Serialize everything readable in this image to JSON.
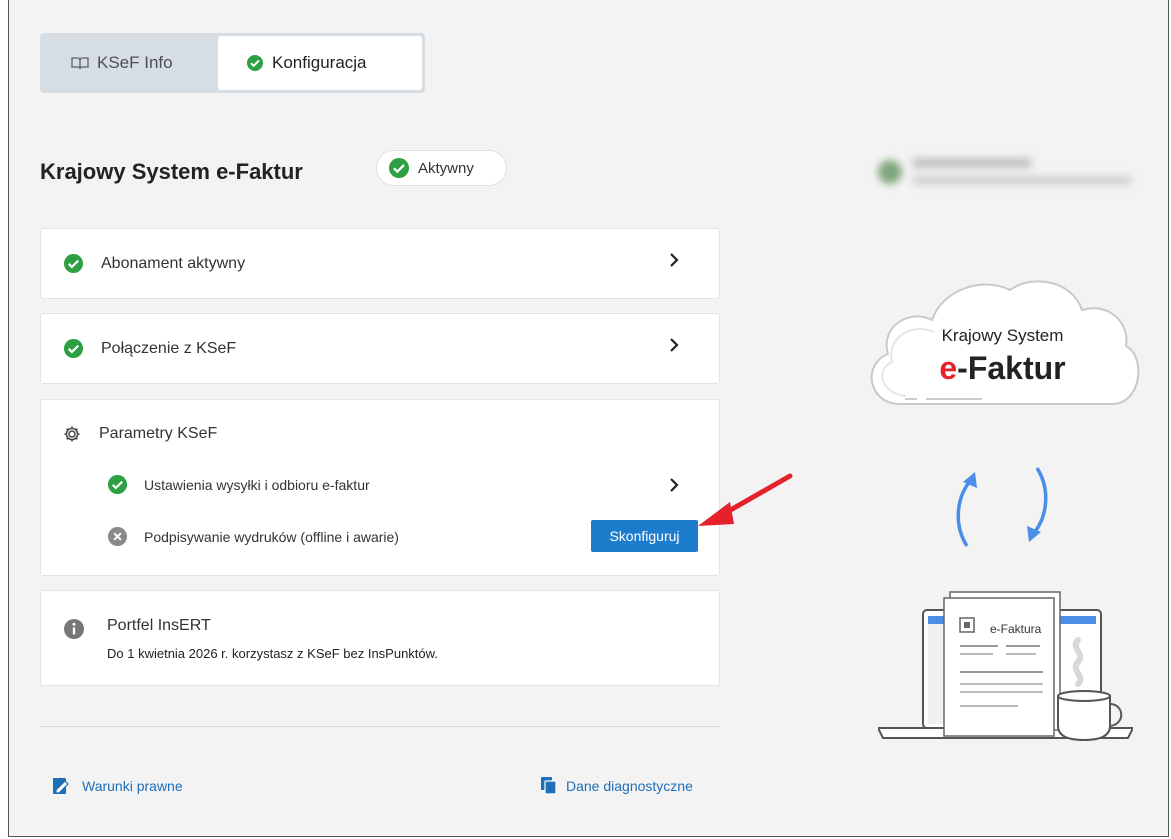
{
  "tabs": [
    {
      "label": "KSeF Info",
      "icon": "book-open-icon"
    },
    {
      "label": "Konfiguracja",
      "icon": "check-circle-icon"
    }
  ],
  "header": {
    "title": "Krajowy System e-Faktur",
    "status_label": "Aktywny"
  },
  "cards": {
    "subscription": {
      "label": "Abonament aktywny"
    },
    "connection": {
      "label": "Połączenie z KSeF"
    },
    "parameters": {
      "title": "Parametry KSeF",
      "items": [
        {
          "label": "Ustawienia wysyłki i odbioru e-faktur",
          "state": "ok"
        },
        {
          "label": "Podpisywanie wydruków (offline i awarie)",
          "state": "not-configured",
          "action_label": "Skonfiguruj"
        }
      ]
    },
    "wallet": {
      "title": "Portfel InsERT",
      "text": "Do 1 kwietnia 2026 r. korzystasz z KSeF bez InsPunktów."
    }
  },
  "footer": {
    "legal_label": "Warunki prawne",
    "diagnostics_label": "Dane diagnostyczne"
  },
  "illustration": {
    "cloud_line1": "Krajowy System",
    "cloud_line2_accent": "e",
    "cloud_line2_rest": "-Faktur",
    "document_label": "e-Faktura"
  },
  "colors": {
    "success": "#2ea043",
    "primary": "#1e7ccd",
    "accent_red": "#e5222c",
    "arrow_blue": "#4a8ee8",
    "muted_gray": "#8a8a8a"
  }
}
